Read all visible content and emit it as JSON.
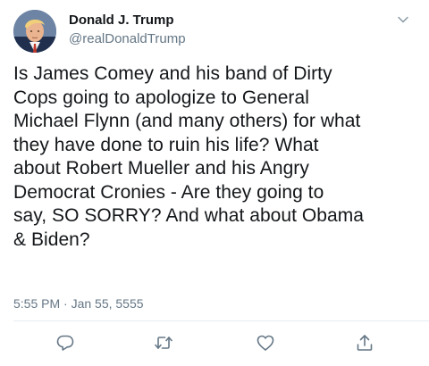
{
  "author": {
    "display_name": "Donald J. Trump",
    "handle": "@realDonaldTrump"
  },
  "tweet": {
    "text": "Is James Comey and his band of Dirty\nCops going to apologize to General\nMichael Flynn (and many others) for what\nthey have done to ruin his life? What\nabout Robert Mueller and his Angry\nDemocrat Cronies - Are they going to\nsay, SO SORRY? And what about Obama\n& Biden?",
    "timestamp": "5:55 PM · Jan 55, 5555"
  },
  "icons": {
    "menu": "chevron-down-icon",
    "reply": "reply-icon",
    "retweet": "retweet-icon",
    "like": "heart-icon",
    "share": "share-icon"
  },
  "colors": {
    "text": "#14171a",
    "secondary": "#657786",
    "icon": "#657786",
    "divider": "#e6ecf0"
  }
}
